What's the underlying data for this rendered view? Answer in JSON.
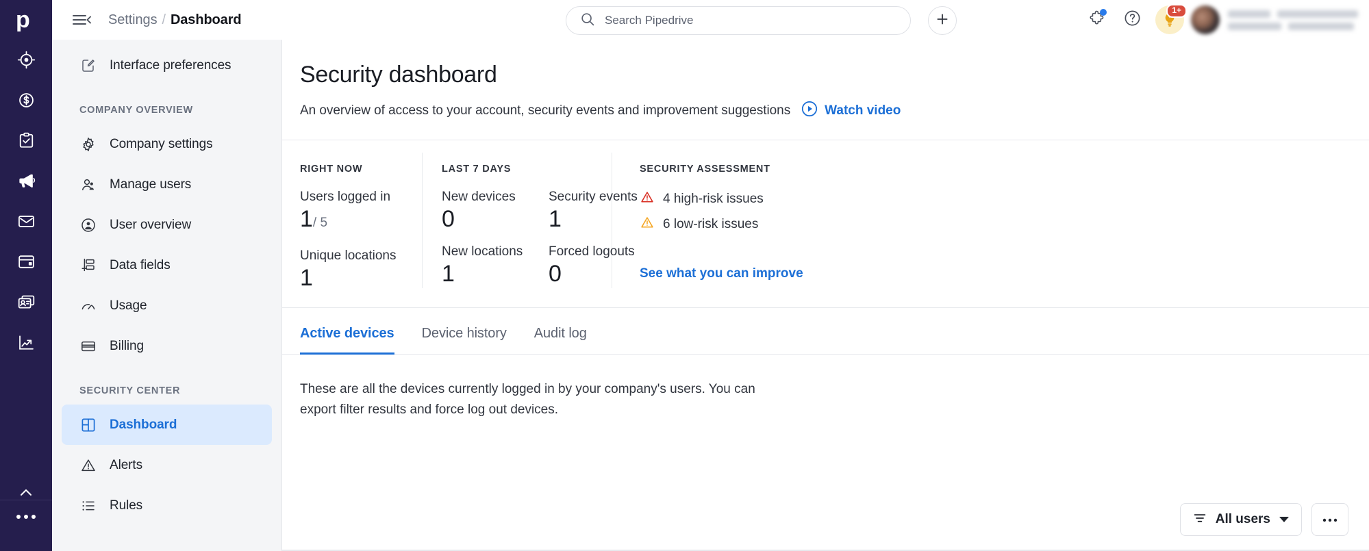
{
  "brand": {
    "logo_icon": "pipedrive-logo-icon",
    "rail_bg": "#251E4D",
    "accent_blue": "#1C6FD6",
    "active_nav_bg": "#DBEAFE",
    "high_risk_color": "#D93025",
    "low_risk_color": "#F5A623"
  },
  "rail": {
    "items": [
      {
        "name": "leads-icon",
        "label": "Leads"
      },
      {
        "name": "deals-icon",
        "label": "Deals"
      },
      {
        "name": "activities-icon",
        "label": "Activities"
      },
      {
        "name": "campaigns-icon",
        "label": "Campaigns"
      },
      {
        "name": "mail-icon",
        "label": "Mail"
      },
      {
        "name": "projects-icon",
        "label": "Projects"
      },
      {
        "name": "contacts-icon",
        "label": "Contacts"
      },
      {
        "name": "insights-icon",
        "label": "Insights"
      }
    ],
    "more_icon": "more-dots-icon",
    "collapse_icon": "chevron-up-icon"
  },
  "topbar": {
    "menu_icon": "hamburger-collapse-icon",
    "breadcrumb": {
      "parent": "Settings",
      "separator": "/",
      "current": "Dashboard"
    },
    "search": {
      "placeholder": "Search Pipedrive",
      "value": "",
      "icon": "search-icon"
    },
    "add_icon": "plus-icon",
    "marketplace_icon": "puzzle-icon",
    "help_icon": "question-mark-icon",
    "tips_icon": "lightbulb-icon",
    "tips_badge": "1+",
    "avatar_icon": "user-avatar"
  },
  "settings_nav": {
    "top_items": [
      {
        "label": "Interface preferences",
        "icon": "interface-preferences-icon",
        "active": false
      }
    ],
    "groups": [
      {
        "title": "COMPANY OVERVIEW",
        "items": [
          {
            "label": "Company settings",
            "icon": "gear-icon",
            "active": false
          },
          {
            "label": "Manage users",
            "icon": "users-icon",
            "active": false
          },
          {
            "label": "User overview",
            "icon": "user-circle-icon",
            "active": false
          },
          {
            "label": "Data fields",
            "icon": "data-fields-icon",
            "active": false
          },
          {
            "label": "Usage",
            "icon": "gauge-icon",
            "active": false
          },
          {
            "label": "Billing",
            "icon": "credit-card-icon",
            "active": false
          }
        ]
      },
      {
        "title": "SECURITY CENTER",
        "items": [
          {
            "label": "Dashboard",
            "icon": "dashboard-grid-icon",
            "active": true
          },
          {
            "label": "Alerts",
            "icon": "warning-triangle-icon",
            "active": false
          },
          {
            "label": "Rules",
            "icon": "list-rules-icon",
            "active": false
          }
        ]
      }
    ]
  },
  "page": {
    "title": "Security dashboard",
    "subtitle": "An overview of access to your account, security events and improvement suggestions",
    "watch_video": {
      "label": "Watch video",
      "icon": "play-circle-icon"
    }
  },
  "stats": {
    "right_now": {
      "label": "RIGHT NOW",
      "metrics": [
        {
          "name": "Users logged in",
          "value": "1",
          "of": "/ 5"
        },
        {
          "name": "Unique locations",
          "value": "1",
          "of": ""
        }
      ]
    },
    "last_7_days": {
      "label": "LAST 7 DAYS",
      "metrics_col1": [
        {
          "name": "New devices",
          "value": "0"
        },
        {
          "name": "New locations",
          "value": "1"
        }
      ],
      "metrics_col2": [
        {
          "name": "Security events",
          "value": "1"
        },
        {
          "name": "Forced logouts",
          "value": "0"
        }
      ]
    },
    "assessment": {
      "label": "SECURITY ASSESSMENT",
      "rows": [
        {
          "text": "4 high-risk issues",
          "icon": "high-risk-warning-icon",
          "severity": "high"
        },
        {
          "text": "6 low-risk issues",
          "icon": "low-risk-warning-icon",
          "severity": "low"
        }
      ],
      "link": "See what you can improve"
    }
  },
  "tabs": [
    {
      "label": "Active devices",
      "active": true
    },
    {
      "label": "Device history",
      "active": false
    },
    {
      "label": "Audit log",
      "active": false
    }
  ],
  "panel": {
    "description": "These are all the devices currently logged in by your company's users. You can export filter results and force log out devices."
  },
  "toolbar": {
    "filter": {
      "label": "All users",
      "icon": "filter-icon",
      "caret": "chevron-down-icon"
    },
    "more": {
      "label": "···",
      "icon": "more-dots-icon"
    }
  }
}
